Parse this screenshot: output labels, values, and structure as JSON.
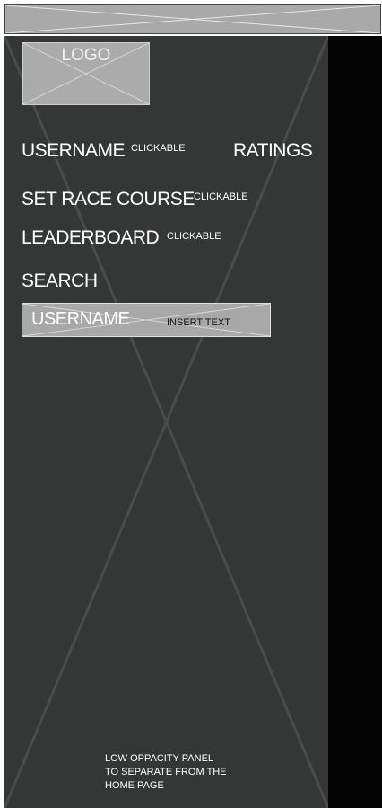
{
  "logo": {
    "label": "LOGO"
  },
  "menu": {
    "username": {
      "label": "USERNAME",
      "note": "CLICKABLE"
    },
    "ratings": {
      "label": "RATINGS"
    },
    "set_race_course": {
      "label": "SET RACE COURSE",
      "note": "CLICKABLE"
    },
    "leaderboard": {
      "label": "LEADERBOARD",
      "note": "CLICKABLE"
    }
  },
  "search": {
    "label": "SEARCH",
    "value": "USERNAME",
    "hint": "INSERT TEXT"
  },
  "panel_note": {
    "line1": "LOW OPPACITY PANEL",
    "line2": "TO SEPARATE FROM THE",
    "line3": "HOME PAGE"
  }
}
